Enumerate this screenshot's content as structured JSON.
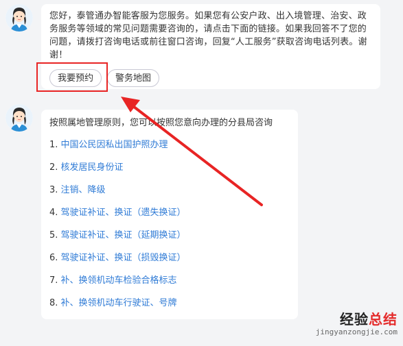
{
  "messages": [
    {
      "text": "您好，泰管通办智能客服为您服务。如果您有公安户政、出入境管理、治安、政务服务等领域的常见问题需要咨询的，请点击下面的链接。如果我回答不了您的问题，请拨打咨询电话或前往窗口咨询，回复“人工服务”获取咨询电话列表。谢谢！",
      "buttons": [
        "我要预约",
        "警务地图"
      ]
    },
    {
      "intro": "按照属地管理原则，您可以按照您意向办理的分县局咨询",
      "links": [
        {
          "num": "1.",
          "label": "中国公民因私出国护照办理"
        },
        {
          "num": "2.",
          "label": "核发居民身份证"
        },
        {
          "num": "3.",
          "label": "注销、降级"
        },
        {
          "num": "4.",
          "label": "驾驶证补证、换证（遗失换证）"
        },
        {
          "num": "5.",
          "label": "驾驶证补证、换证（延期换证）"
        },
        {
          "num": "6.",
          "label": "驾驶证补证、换证（损毁换证）"
        },
        {
          "num": "7.",
          "label": "补、换领机动车检验合格标志"
        },
        {
          "num": "8.",
          "label": "补、换领机动车行驶证、号牌"
        }
      ]
    }
  ],
  "watermark": {
    "title_black": "经验",
    "title_red": "总结",
    "url": "jingyanzongjie.com"
  },
  "colors": {
    "link": "#2f7bd6",
    "annotation": "#e82424",
    "background": "#f3f4f6"
  },
  "icons": [
    "agent-avatar-icon",
    "annotation-arrow-icon"
  ]
}
